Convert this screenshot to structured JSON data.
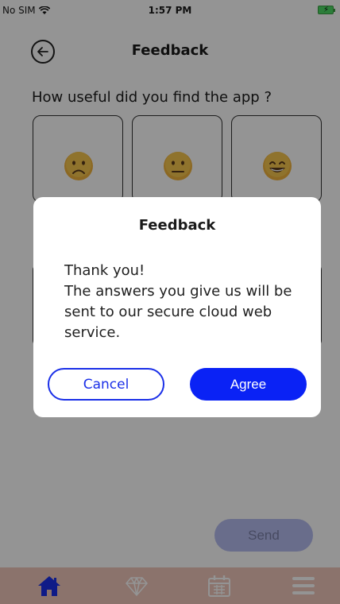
{
  "status_bar": {
    "carrier": "No SIM",
    "time": "1:57 PM"
  },
  "header": {
    "title": "Feedback",
    "back_icon": "back-arrow-circle-icon"
  },
  "question": {
    "text": "How useful did you find the app ?"
  },
  "ratings": [
    {
      "icon": "sad-face-icon"
    },
    {
      "icon": "neutral-face-icon"
    },
    {
      "icon": "happy-face-icon"
    }
  ],
  "send": {
    "label": "Send"
  },
  "tab_bar": {
    "items": [
      {
        "icon": "home-icon",
        "active": true
      },
      {
        "icon": "diamond-icon",
        "active": false
      },
      {
        "icon": "calendar-icon",
        "active": false
      },
      {
        "icon": "menu-icon",
        "active": false
      }
    ],
    "active_color": "#1a2fe8",
    "inactive_color": "#ffffff"
  },
  "dialog": {
    "title": "Feedback",
    "message": "Thank you!\nThe answers you give us will be sent to our secure cloud web service.",
    "cancel_label": "Cancel",
    "agree_label": "Agree"
  },
  "colors": {
    "accent": "#0a22f5",
    "tab_bar_bg": "#efc6bb"
  }
}
